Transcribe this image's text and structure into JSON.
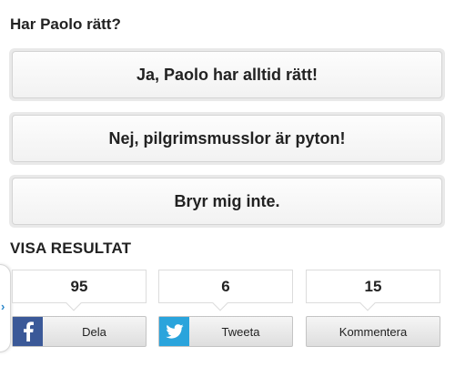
{
  "poll": {
    "question": "Har Paolo rätt?",
    "options": [
      "Ja, Paolo har alltid rätt!",
      "Nej, pilgrimsmusslor är pyton!",
      "Bryr mig inte."
    ],
    "results_label": "VISA RESULTAT"
  },
  "social": {
    "facebook": {
      "count": "95",
      "label": "Dela",
      "icon": "facebook-icon",
      "color": "#3b5998"
    },
    "twitter": {
      "count": "6",
      "label": "Tweeta",
      "icon": "twitter-icon",
      "color": "#2aa4dc"
    },
    "comments": {
      "count": "15",
      "label": "Kommentera"
    }
  },
  "side_tab": {
    "icon": "chevron-right-icon",
    "color": "#2a86c9"
  }
}
